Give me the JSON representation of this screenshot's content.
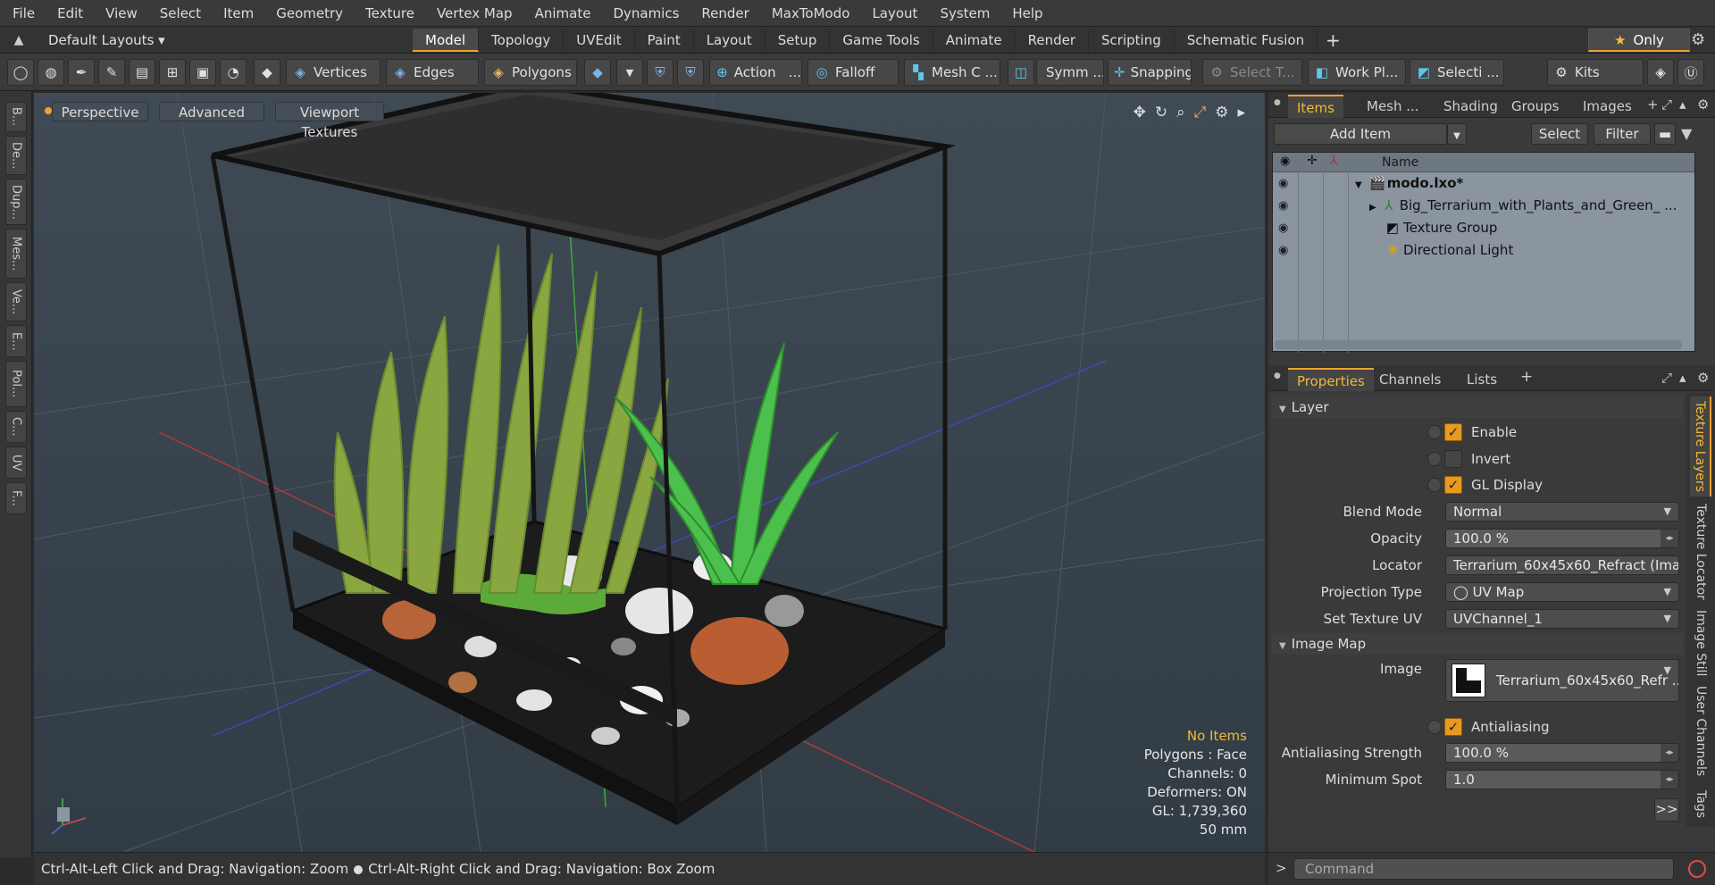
{
  "menu": [
    "File",
    "Edit",
    "View",
    "Select",
    "Item",
    "Geometry",
    "Texture",
    "Vertex Map",
    "Animate",
    "Dynamics",
    "Render",
    "MaxToModo",
    "Layout",
    "System",
    "Help"
  ],
  "layout_selector": "Default Layouts ▾",
  "layout_tabs": [
    "Model",
    "Topology",
    "UVEdit",
    "Paint",
    "Layout",
    "Setup",
    "Game Tools",
    "Animate",
    "Render",
    "Scripting",
    "Schematic Fusion"
  ],
  "only_label": "Only",
  "toolbar": {
    "vertices": "Vertices",
    "edges": "Edges",
    "polygons": "Polygons",
    "action": "Action",
    "falloff": "Falloff",
    "mesh": "Mesh C ...",
    "symm": "Symm ...",
    "snapping": "Snapping",
    "select_t": "Select T...",
    "work_pl": "Work Pl...",
    "selecti": "Selecti ...",
    "kits": "Kits"
  },
  "left_tools": [
    "B...",
    "De...",
    "Dup...",
    "Mes...",
    "Ve...",
    "E...",
    "Pol...",
    "C...",
    "UV",
    "F..."
  ],
  "viewport": {
    "perspective": "Perspective",
    "advanced": "Advanced",
    "textures": "Viewport Textures",
    "info": {
      "items": "No Items",
      "polygons": "Polygons : Face",
      "channels": "Channels: 0",
      "deformers": "Deformers: ON",
      "gl": "GL: 1,739,360",
      "lens": "50 mm"
    }
  },
  "status": {
    "left": "Ctrl-Alt-Left Click and Drag: Navigation: Zoom",
    "right": "Ctrl-Alt-Right Click and Drag: Navigation: Box Zoom"
  },
  "items_panel": {
    "tabs": [
      "Items",
      "Mesh ...",
      "Shading",
      "Groups",
      "Images"
    ],
    "add_item": "Add Item",
    "select": "Select",
    "filter": "Filter",
    "name_header": "Name",
    "rows": [
      {
        "label": "modo.lxo*",
        "bold": true
      },
      {
        "label": "Big_Terrarium_with_Plants_and_Green_ ..."
      },
      {
        "label": "Texture Group"
      },
      {
        "label": "Directional Light"
      }
    ]
  },
  "properties": {
    "tabs": [
      "Properties",
      "Channels",
      "Lists"
    ],
    "layer_section": "Layer",
    "enable": "Enable",
    "invert": "Invert",
    "gl_display": "GL Display",
    "blend_mode_label": "Blend Mode",
    "blend_mode": "Normal",
    "opacity_label": "Opacity",
    "opacity": "100.0 %",
    "locator_label": "Locator",
    "locator": "Terrarium_60x45x60_Refract (Ima ...",
    "projection_label": "Projection Type",
    "projection": "UV Map",
    "set_uv_label": "Set Texture UV",
    "set_uv": "UVChannel_1",
    "image_map_section": "Image Map",
    "image_label": "Image",
    "image": "Terrarium_60x45x60_Refr ...",
    "antialiasing": "Antialiasing",
    "aa_strength_label": "Antialiasing Strength",
    "aa_strength": "100.0 %",
    "min_spot_label": "Minimum Spot",
    "min_spot": "1.0",
    "more": ">>"
  },
  "side_tabs": [
    "Texture Layers",
    "Texture Locator",
    "Image Still",
    "User Channels",
    "Tags"
  ],
  "command_placeholder": "Command"
}
